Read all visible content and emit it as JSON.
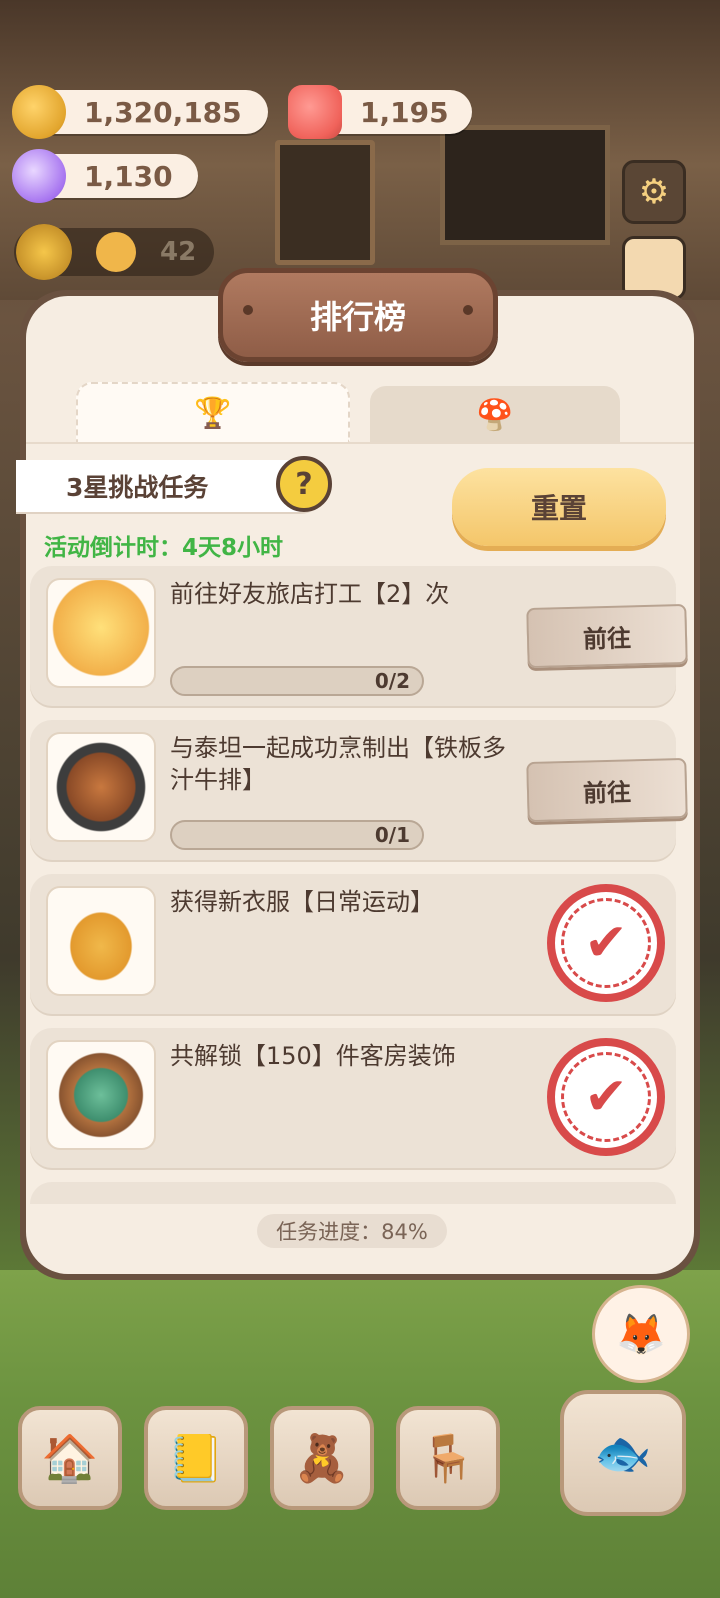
{
  "currencies": {
    "coins": "1,320,185",
    "candles": "1,195",
    "gems": "1,130",
    "level": "42"
  },
  "panel": {
    "title": "排行榜",
    "tabs": [
      {
        "icon": "trophy-icon",
        "glyph": "🏆",
        "active": true
      },
      {
        "icon": "mushroom-icon",
        "glyph": "🍄",
        "active": false
      }
    ],
    "section_title": "3星挑战任务",
    "help_label": "?",
    "countdown": "活动倒计时：4天8小时",
    "reset_label": "重置",
    "footer_progress": "任务进度：84%"
  },
  "tasks": [
    {
      "text": "前往好友旅店打工【2】次",
      "progress": "0/2",
      "progress_value": 0,
      "action": "前往",
      "completed": false,
      "image": "worker-icon"
    },
    {
      "text": "与泰坦一起成功烹制出【铁板多汁牛排】",
      "progress": "0/1",
      "progress_value": 0,
      "action": "前往",
      "completed": false,
      "image": "steak-icon"
    },
    {
      "text": "获得新衣服【日常运动】",
      "completed": true,
      "image": "outfit-icon"
    },
    {
      "text": "共解锁【150】件客房装饰",
      "completed": true,
      "image": "decoration-badge-icon"
    }
  ],
  "stamp_glyph": "✔",
  "colors": {
    "accent_green": "#41b545",
    "stamp_red": "#d84a4a",
    "reset_yellow": "#f4c66a"
  }
}
